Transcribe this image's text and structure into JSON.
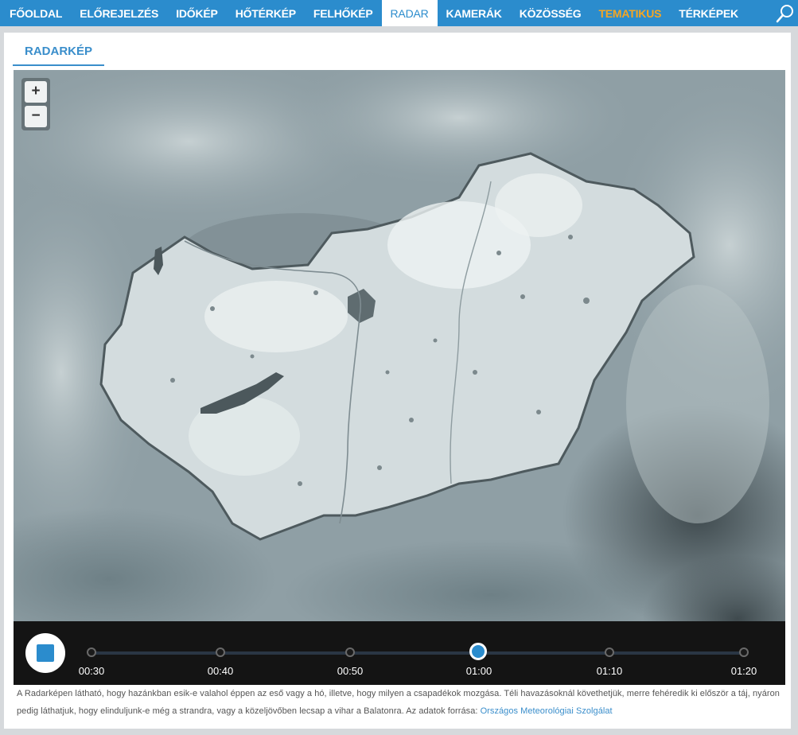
{
  "nav": {
    "items": [
      {
        "label": "FŐOLDAL"
      },
      {
        "label": "ELŐREJELZÉS"
      },
      {
        "label": "IDŐKÉP"
      },
      {
        "label": "HŐTÉRKÉP"
      },
      {
        "label": "FELHŐKÉP"
      },
      {
        "label": "RADAR"
      },
      {
        "label": "KAMERÁK"
      },
      {
        "label": "KÖZÖSSÉG"
      },
      {
        "label": "TEMATIKUS"
      },
      {
        "label": "TÉRKÉPEK"
      }
    ],
    "active": "RADAR",
    "accent_item": "TEMATIKUS",
    "accent_color": "#f5a623",
    "bar_color": "#2b8ccd",
    "search_icon": "search-icon"
  },
  "section": {
    "title": "RADARKÉP"
  },
  "map": {
    "zoom_in_label": "+",
    "zoom_out_label": "−"
  },
  "timeline": {
    "stop_icon": "stop-icon",
    "times": [
      "00:30",
      "00:40",
      "00:50",
      "01:00",
      "01:10",
      "01:20"
    ],
    "current": "01:00"
  },
  "caption": {
    "text": "A Radarképen látható, hogy hazánkban esik-e valahol éppen az eső vagy a hó, illetve, hogy milyen a csapadékok mozgása. Téli havazásoknál követhetjük, merre fehéredik ki először a táj, nyáron pedig láthatjuk, hogy elinduljunk-e még a strandra, vagy a közeljövőben lecsap a vihar a Balatonra. Az adatok forrása: ",
    "link": "Országos Meteorológiai Szolgálat"
  }
}
